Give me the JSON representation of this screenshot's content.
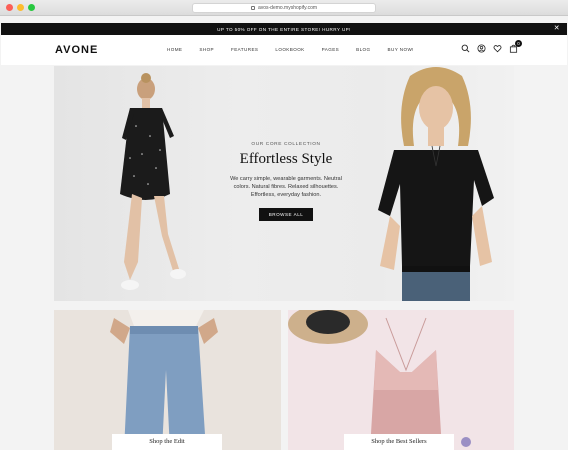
{
  "browser": {
    "url": "avos-demo.myshopify.com"
  },
  "announcement": {
    "text": "UP TO 50% OFF ON THE ENTIRE STORE! HURRY UP!",
    "close": "✕"
  },
  "header": {
    "logo": "AVONE",
    "nav": [
      "HOME",
      "SHOP",
      "FEATURES",
      "LOOKBOOK",
      "PAGES",
      "BLOG",
      "BUY NOW!"
    ],
    "cart_count": "0"
  },
  "hero": {
    "eyebrow": "OUR CORE COLLECTION",
    "title": "Effortless Style",
    "description_lines": [
      "We carry simple, wearable garments. Neutral",
      "colors. Natural fibres. Relaxed silhouettes.",
      "Effortless, everyday fashion."
    ],
    "button": "BROWSE ALL"
  },
  "banners": [
    {
      "label": "Shop the Edit"
    },
    {
      "label": "Shop the Best Sellers"
    }
  ],
  "colors": {
    "announce_bg": "#111111",
    "button_bg": "#111111",
    "hero_bg": "#ebebeb"
  }
}
